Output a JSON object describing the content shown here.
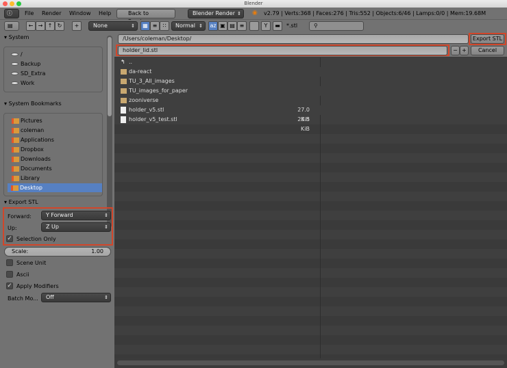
{
  "window": {
    "title": "Blender"
  },
  "header": {
    "menus": [
      "File",
      "Render",
      "Window",
      "Help"
    ],
    "back_button": "Back to Previous",
    "engine": "Blender Render",
    "stats": "v2.79 | Verts:368 | Faces:276 | Tris:552 | Objects:6/46 | Lamps:0/0 | Mem:19.68M"
  },
  "toolbar": {
    "recent_select": "None",
    "display_select": "Normal",
    "filter_text": "*.stl",
    "search_placeholder": ""
  },
  "sidebar": {
    "system_title": "System",
    "system_items": [
      "/",
      "Backup",
      "SD_Extra",
      "Work"
    ],
    "bookmarks_title": "System Bookmarks",
    "bookmarks": [
      "Pictures",
      "coleman",
      "Applications",
      "Dropbox",
      "Downloads",
      "Documents",
      "Library",
      "Desktop"
    ],
    "active_bookmark": "Desktop",
    "export_title": "Export STL",
    "forward_label": "Forward:",
    "forward_value": "Y Forward",
    "up_label": "Up:",
    "up_value": "Z Up",
    "selection_only": "Selection Only",
    "scale_label": "Scale:",
    "scale_value": "1.00",
    "scene_unit": "Scene Unit",
    "ascii": "Ascii",
    "apply_modifiers": "Apply Modifiers",
    "batch_label": "Batch Mo...",
    "batch_value": "Off"
  },
  "browser": {
    "path": "/Users/coleman/Desktop/",
    "filename": "holder_lid.stl",
    "export_button": "Export STL",
    "cancel_button": "Cancel",
    "parent": "..",
    "folders": [
      "da-react",
      "TU_3_All_images",
      "TU_images_for_paper",
      "zooniverse"
    ],
    "files": [
      {
        "name": "holder_v5.stl",
        "size": "27.0 KiB"
      },
      {
        "name": "holder_v5_test.stl",
        "size": "23.5 KiB"
      }
    ]
  }
}
